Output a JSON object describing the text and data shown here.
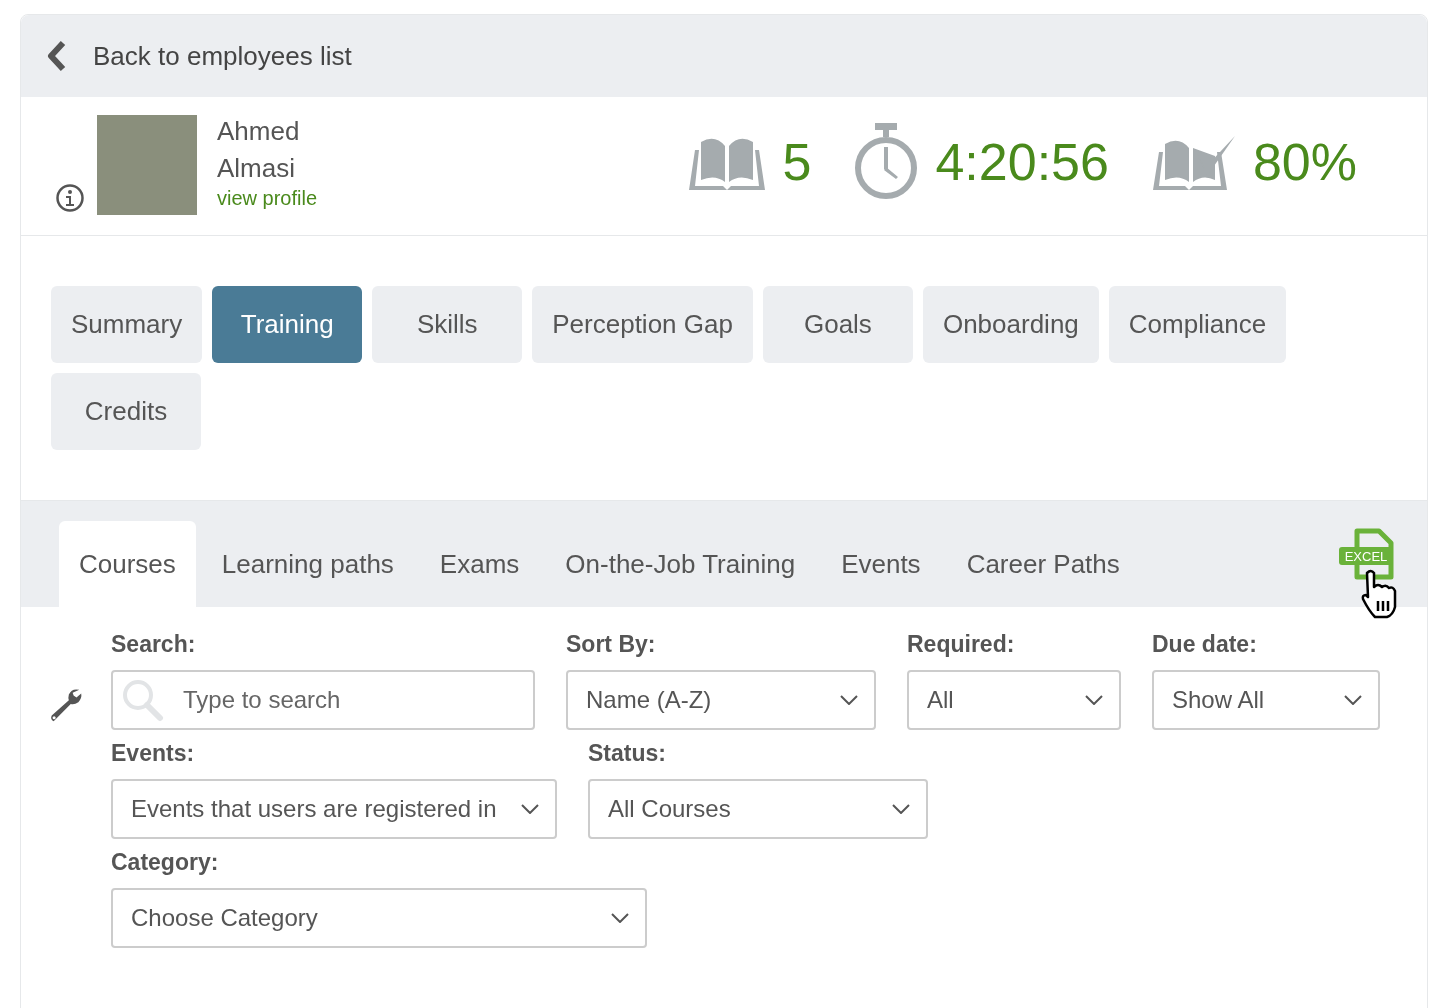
{
  "back_link": {
    "label": "Back to employees list"
  },
  "profile": {
    "first_name": "Ahmed",
    "last_name": "Almasi",
    "link": "view profile"
  },
  "stats": [
    {
      "kind": "courses",
      "value": "5"
    },
    {
      "kind": "time",
      "value": "4:20:56"
    },
    {
      "kind": "completion",
      "value": "80%"
    }
  ],
  "tabs": [
    {
      "label": "Summary",
      "selected": false
    },
    {
      "label": "Training",
      "selected": true
    },
    {
      "label": "Skills",
      "selected": false
    },
    {
      "label": "Perception Gap",
      "selected": false
    },
    {
      "label": "Goals",
      "selected": false
    },
    {
      "label": "Onboarding",
      "selected": false
    },
    {
      "label": "Compliance",
      "selected": false
    },
    {
      "label": "Credits",
      "selected": false
    }
  ],
  "subtabs": [
    {
      "label": "Courses",
      "selected": true
    },
    {
      "label": "Learning paths",
      "selected": false
    },
    {
      "label": "Exams",
      "selected": false
    },
    {
      "label": "On-the-Job Training",
      "selected": false
    },
    {
      "label": "Events",
      "selected": false
    },
    {
      "label": "Career Paths",
      "selected": false
    }
  ],
  "export": {
    "label": "EXCEL"
  },
  "filter_rows": [
    [
      {
        "kind": "search",
        "label": "Search:",
        "placeholder": "Type to search"
      },
      {
        "kind": "select",
        "label": "Sort By:",
        "value": "Name (A-Z)"
      },
      {
        "kind": "select",
        "label": "Required:",
        "value": "All"
      },
      {
        "kind": "select",
        "label": "Due date:",
        "value": "Show All"
      }
    ],
    [
      {
        "kind": "select",
        "label": "Events:",
        "value": "Events that users are registered in"
      },
      {
        "kind": "select",
        "label": "Status:",
        "value": "All Courses"
      }
    ],
    [
      {
        "kind": "select",
        "label": "Category:",
        "value": "Choose Category"
      }
    ]
  ]
}
